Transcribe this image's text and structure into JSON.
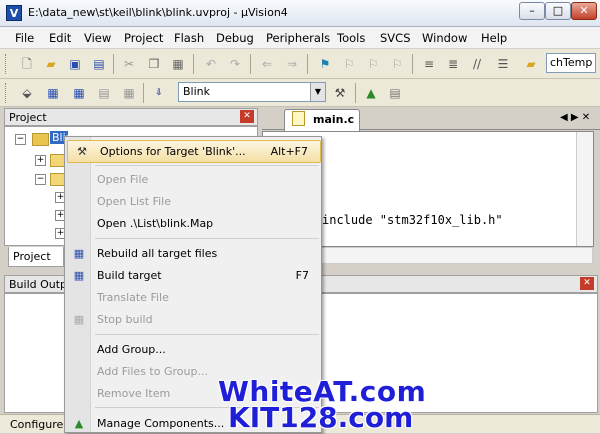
{
  "window": {
    "title": "E:\\data_new\\st\\keil\\blink\\blink.uvproj - µVision4",
    "app_icon_letter": "V",
    "minimize": "–",
    "maximize": "□",
    "close": "✕"
  },
  "menubar": [
    "File",
    "Edit",
    "View",
    "Project",
    "Flash",
    "Debug",
    "Peripherals",
    "Tools",
    "SVCS",
    "Window",
    "Help"
  ],
  "toolbar": {
    "find_value": "chTemp",
    "target_value": "Blink",
    "target_arrow": "▼"
  },
  "project_panel": {
    "title": "Project",
    "close": "✕",
    "root_label": "Blink",
    "tab_label": "Project"
  },
  "editor": {
    "tab_label": "main.c",
    "code_line": "include \"stm32f10x_lib.h\"",
    "nav_left": "◀",
    "nav_right": "▶",
    "nav_close": "✕"
  },
  "build_panel": {
    "title": "Build Outp",
    "close": "✕"
  },
  "statusbar": {
    "text": "Configure"
  },
  "context_menu": {
    "items": [
      {
        "label": "Options for Target 'Blink'...",
        "shortcut": "Alt+F7",
        "enabled": true,
        "highlighted": true
      },
      {
        "label": "Open File",
        "shortcut": "",
        "enabled": false
      },
      {
        "label": "Open List File",
        "shortcut": "",
        "enabled": false
      },
      {
        "label": "Open .\\List\\blink.Map",
        "shortcut": "",
        "enabled": true
      },
      {
        "label": "Rebuild all target files",
        "shortcut": "",
        "enabled": true
      },
      {
        "label": "Build target",
        "shortcut": "F7",
        "enabled": true
      },
      {
        "label": "Translate File",
        "shortcut": "",
        "enabled": false
      },
      {
        "label": "Stop build",
        "shortcut": "",
        "enabled": false
      },
      {
        "label": "Add Group...",
        "shortcut": "",
        "enabled": true
      },
      {
        "label": "Add Files to Group...",
        "shortcut": "",
        "enabled": false
      },
      {
        "label": "Remove Item",
        "shortcut": "",
        "enabled": false
      },
      {
        "label": "Manage Components...",
        "shortcut": "",
        "enabled": true
      }
    ]
  },
  "watermark": {
    "line1": "WhiteAT.com",
    "line2": "KIT128.com"
  },
  "colors": {
    "highlight": "#f4dfa5",
    "watermark": "#1f1fd8"
  }
}
